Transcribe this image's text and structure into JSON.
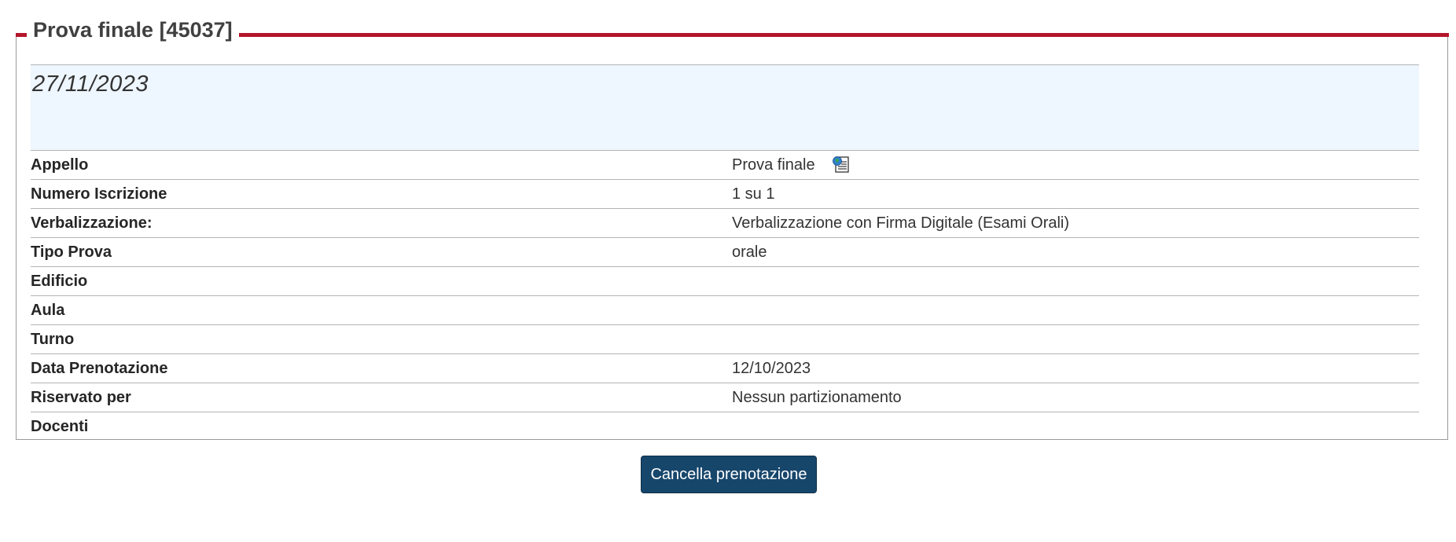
{
  "section": {
    "title": "Prova finale [45037]",
    "accent_color": "#b5152b"
  },
  "exam_date": "27/11/2023",
  "details": [
    {
      "label": "Appello",
      "value": "Prova finale",
      "icon": "document-globe-icon"
    },
    {
      "label": "Numero Iscrizione",
      "value": "1 su 1"
    },
    {
      "label": "Verbalizzazione:",
      "value": "Verbalizzazione con Firma Digitale (Esami Orali)"
    },
    {
      "label": "Tipo Prova",
      "value": "orale"
    },
    {
      "label": "Edificio",
      "value": ""
    },
    {
      "label": "Aula",
      "value": ""
    },
    {
      "label": "Turno",
      "value": ""
    },
    {
      "label": "Data Prenotazione",
      "value": "12/10/2023"
    },
    {
      "label": "Riservato per",
      "value": "Nessun partizionamento"
    },
    {
      "label": "Docenti",
      "value": ""
    }
  ],
  "actions": {
    "cancel_label": "Cancella prenotazione",
    "button_color": "#17466b"
  }
}
